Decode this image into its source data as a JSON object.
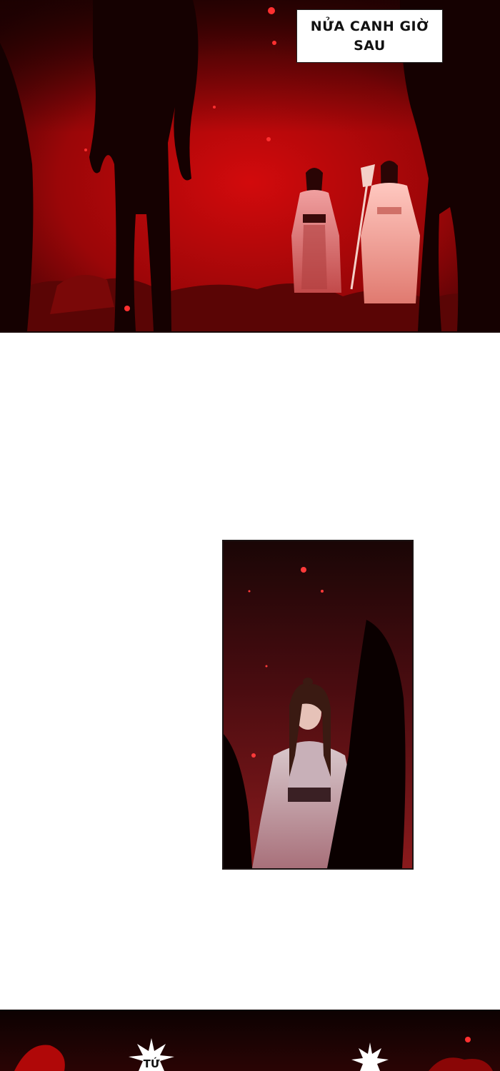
{
  "comic": {
    "caption_time": "NỬA CANH GIỜ SAU",
    "bottom_burst_text": "TỨ"
  },
  "colors": {
    "blood_red": "#c4080c",
    "dark_red": "#3a0606",
    "shadow": "#0e0202",
    "page_bg": "#ffffff"
  }
}
